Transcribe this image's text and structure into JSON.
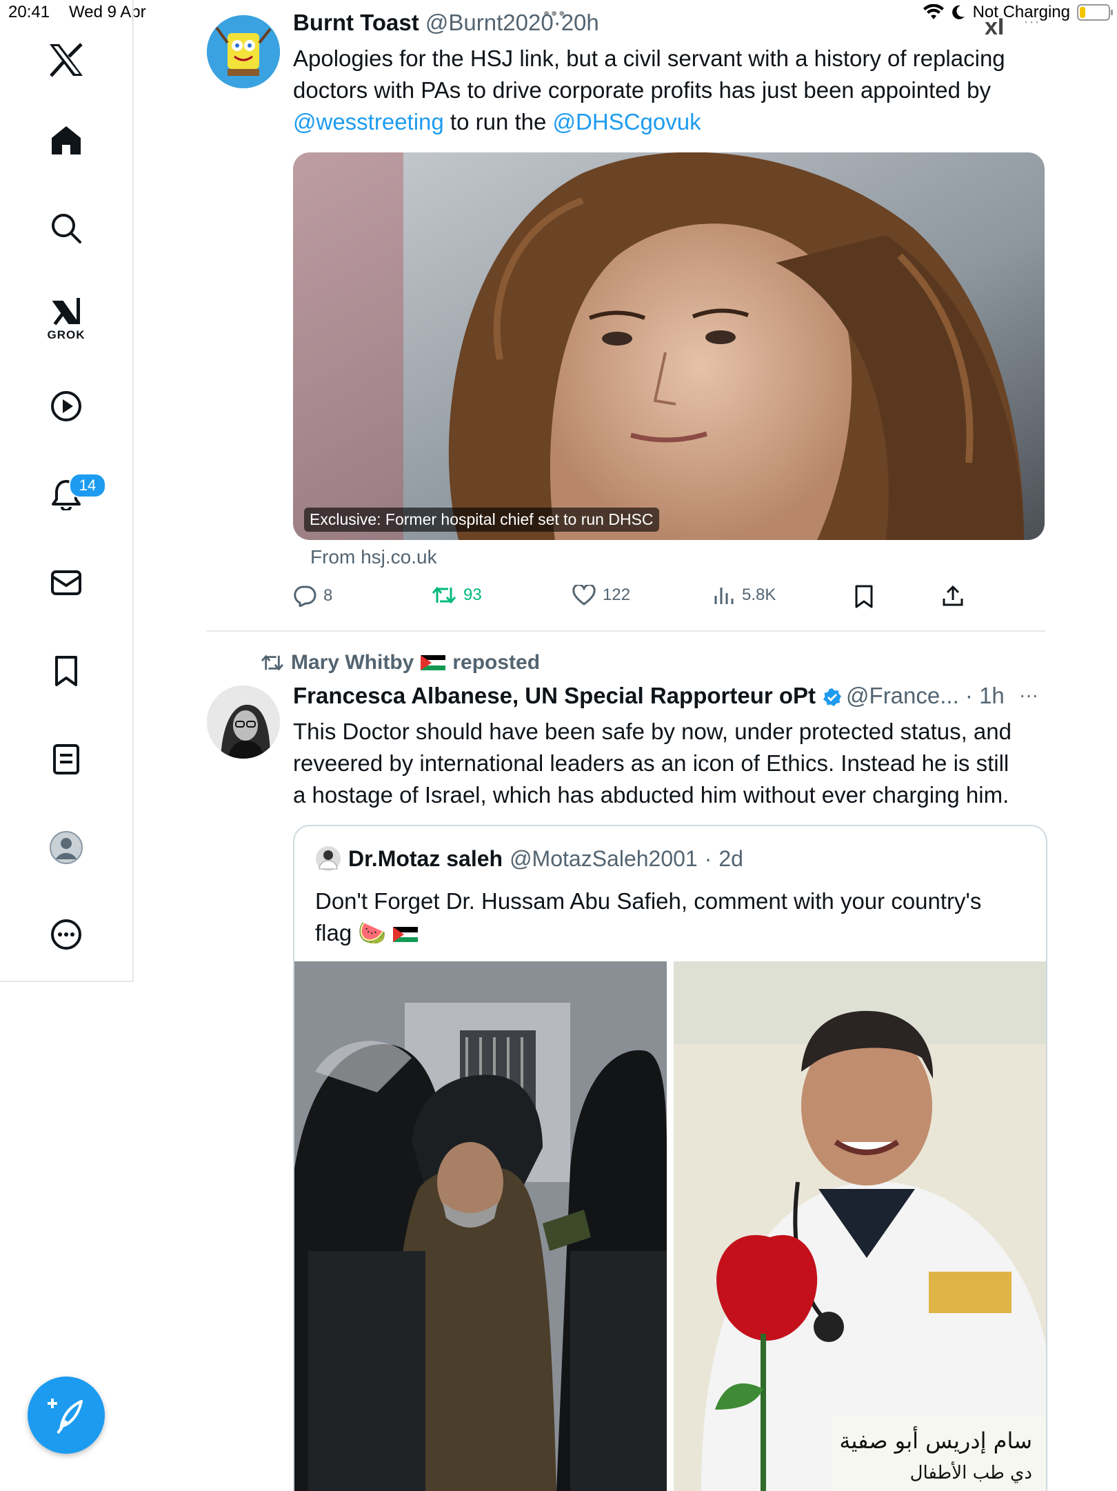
{
  "status_bar": {
    "time": "20:41",
    "date": "Wed 9 Apr",
    "charging": "Not Charging"
  },
  "top_overlay": {
    "grok_mark": "xI",
    "more": "···",
    "dots": "•••"
  },
  "sidebar": {
    "grok_label": "GROK",
    "notifications_badge": "14",
    "items": [
      "x-logo",
      "home",
      "search",
      "grok",
      "video",
      "notifications",
      "messages",
      "bookmarks",
      "lists",
      "profile",
      "more"
    ]
  },
  "tweet1": {
    "author_name": "Burnt Toast",
    "handle": "@Burnt2020",
    "time": "20h",
    "text_line1": "Apologies for the HSJ link, but a civil servant with a history of replacing",
    "text_line2": "doctors with PAs to drive corporate profits has just been appointed by",
    "mention1": "@wesstreeting",
    "text_mid": " to run the ",
    "mention2": "@DHSCgovuk",
    "card_caption": "Exclusive: Former hospital chief set to run DHSC",
    "card_source": "From hsj.co.uk",
    "replies": "8",
    "reposts": "93",
    "likes": "122",
    "views": "5.8K"
  },
  "tweet2": {
    "reposter": "Mary Whitby",
    "reposted_label": "reposted",
    "author_name": "Francesca Albanese, UN Special Rapporteur oPt",
    "handle": "@France...",
    "time": "1h",
    "more": "···",
    "text_line1": "This Doctor should have been safe by now, under protected status, and",
    "text_line2": "reveered by international leaders as an icon of Ethics. Instead he is still",
    "text_line3": "a hostage of Israel, which has abducted him without ever charging him.",
    "quote": {
      "author_name": "Dr.Motaz saleh",
      "handle": "@MotazSaleh2001",
      "time": "2d",
      "text_line1": "Don't Forget Dr. Hussam Abu Safieh, comment with your country's",
      "text_line2": "flag 🍉",
      "sign_text": "سام إدريس أبو صفية",
      "sign_text2": "دي طب الأطفال"
    }
  },
  "colors": {
    "accent": "#1d9bf0",
    "repost_green": "#00ba7c",
    "muted": "#536471",
    "text": "#0f1419",
    "border": "#cfd9de"
  }
}
